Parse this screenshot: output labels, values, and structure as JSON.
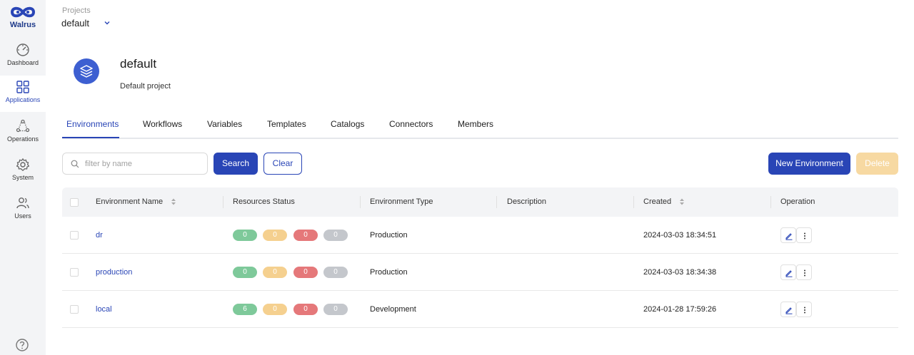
{
  "app": {
    "name": "Walrus"
  },
  "sidebar": {
    "items": [
      {
        "label": "Dashboard",
        "icon": "dashboard-icon",
        "active": false
      },
      {
        "label": "Applications",
        "icon": "grid-icon",
        "active": true
      },
      {
        "label": "Operations",
        "icon": "operations-icon",
        "active": false
      },
      {
        "label": "System",
        "icon": "gear-icon",
        "active": false
      },
      {
        "label": "Users",
        "icon": "users-icon",
        "active": false
      }
    ],
    "help_icon": "help-icon"
  },
  "project_selector": {
    "label": "Projects",
    "value": "default"
  },
  "project": {
    "title": "default",
    "description": "Default project"
  },
  "tabs": [
    {
      "label": "Environments",
      "active": true
    },
    {
      "label": "Workflows"
    },
    {
      "label": "Variables"
    },
    {
      "label": "Templates"
    },
    {
      "label": "Catalogs"
    },
    {
      "label": "Connectors"
    },
    {
      "label": "Members"
    }
  ],
  "toolbar": {
    "search_placeholder": "filter by name",
    "search_label": "Search",
    "clear_label": "Clear",
    "new_label": "New Environment",
    "delete_label": "Delete"
  },
  "table": {
    "columns": [
      "Environment Name",
      "Resources Status",
      "Environment Type",
      "Description",
      "Created",
      "Operation"
    ],
    "rows": [
      {
        "name": "dr",
        "status": [
          "0",
          "0",
          "0",
          "0"
        ],
        "type": "Production",
        "description": "",
        "created": "2024-03-03 18:34:51"
      },
      {
        "name": "production",
        "status": [
          "0",
          "0",
          "0",
          "0"
        ],
        "type": "Production",
        "description": "",
        "created": "2024-03-03 18:34:38"
      },
      {
        "name": "local",
        "status": [
          "6",
          "0",
          "0",
          "0"
        ],
        "type": "Development",
        "description": "",
        "created": "2024-01-28 17:59:26"
      }
    ]
  },
  "colors": {
    "primary": "#2945b6",
    "status_ready": "#7ec99a",
    "status_warning": "#f5d08f",
    "status_error": "#e5787a",
    "status_inactive": "#c4c7cc",
    "delete_disabled": "#f7d9a2"
  }
}
